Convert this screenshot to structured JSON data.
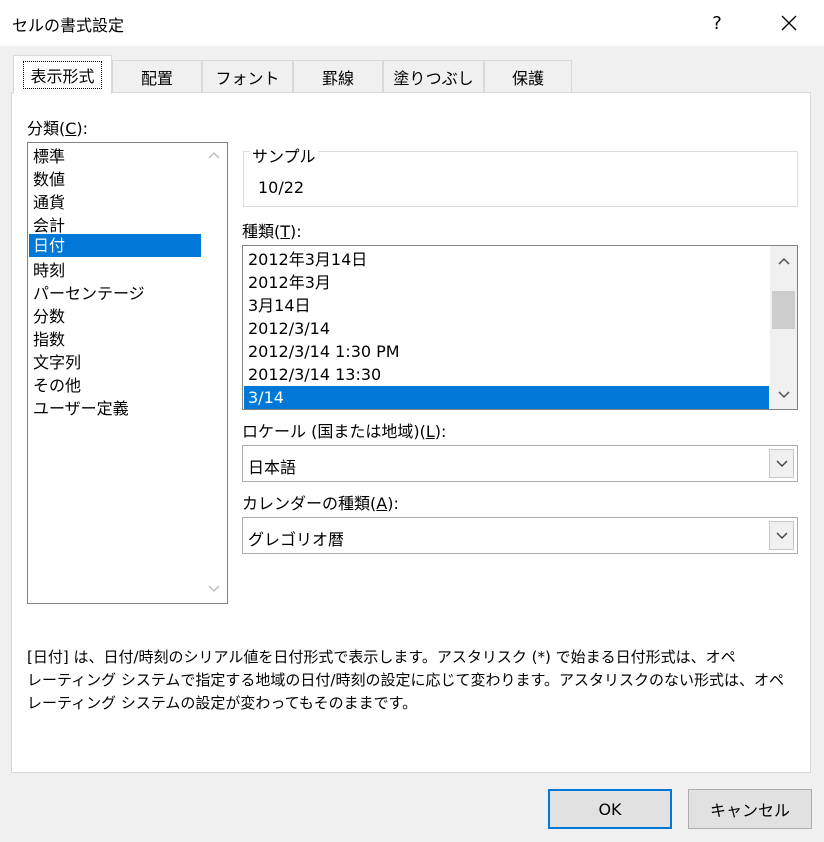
{
  "window": {
    "title": "セルの書式設定",
    "help_label": "?"
  },
  "tabs": [
    {
      "label": "表示形式",
      "active": true
    },
    {
      "label": "配置"
    },
    {
      "label": "フォント"
    },
    {
      "label": "罫線"
    },
    {
      "label": "塗りつぶし"
    },
    {
      "label": "保護"
    }
  ],
  "category": {
    "label_prefix": "分類(",
    "label_key": "C",
    "label_suffix": "):",
    "items": [
      "標準",
      "数値",
      "通貨",
      "会計",
      "日付",
      "時刻",
      "パーセンテージ",
      "分数",
      "指数",
      "文字列",
      "その他",
      "ユーザー定義"
    ],
    "selected": "日付"
  },
  "sample": {
    "title": "サンプル",
    "value": "10/22"
  },
  "type": {
    "label_prefix": "種類(",
    "label_key": "T",
    "label_suffix": "):",
    "items": [
      "2012年3月14日",
      "2012年3月",
      "3月14日",
      "2012/3/14",
      "2012/3/14 1:30 PM",
      "2012/3/14 13:30",
      "3/14"
    ],
    "selected": "3/14"
  },
  "locale": {
    "label_prefix": "ロケール (国または地域)(",
    "label_key": "L",
    "label_suffix": "):",
    "value": "日本語"
  },
  "calendar": {
    "label_prefix": "カレンダーの種類(",
    "label_key": "A",
    "label_suffix": "):",
    "value": "グレゴリオ暦"
  },
  "description": {
    "line1": "[日付] は、日付/時刻のシリアル値を日付形式で表示します。アスタリスク (*) で始まる日付形式は、オペ",
    "line2": "レーティング システムで指定する地域の日付/時刻の設定に応じて変わります。アスタリスクのない形式は、オペ",
    "line3": "レーティング システムの設定が変わってもそのままです。"
  },
  "buttons": {
    "ok": "OK",
    "cancel": "キャンセル"
  },
  "colors": {
    "selection": "#0078d7",
    "panel": "#ffffff",
    "background": "#f0f0f0"
  }
}
